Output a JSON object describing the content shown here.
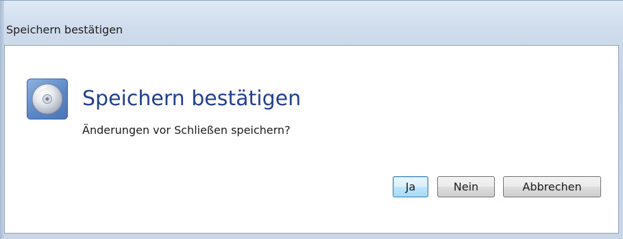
{
  "window": {
    "title": "Speichern bestätigen"
  },
  "dialog": {
    "icon": "disc-icon",
    "heading": "Speichern bestätigen",
    "message": "Änderungen vor Schließen speichern?"
  },
  "buttons": {
    "yes_label": "Ja",
    "no_label": "Nein",
    "cancel_label": "Abbrechen"
  },
  "colors": {
    "heading": "#23408a",
    "default_button_border": "#3c7fb1",
    "icon_background": "#5c87c7"
  }
}
